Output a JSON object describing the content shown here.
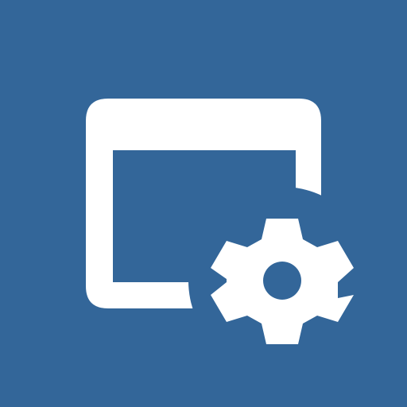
{
  "icon": {
    "name": "window-settings-icon",
    "background_color": "#336699",
    "foreground_color": "#ffffff",
    "parts": [
      "window-icon",
      "gear-icon"
    ]
  }
}
